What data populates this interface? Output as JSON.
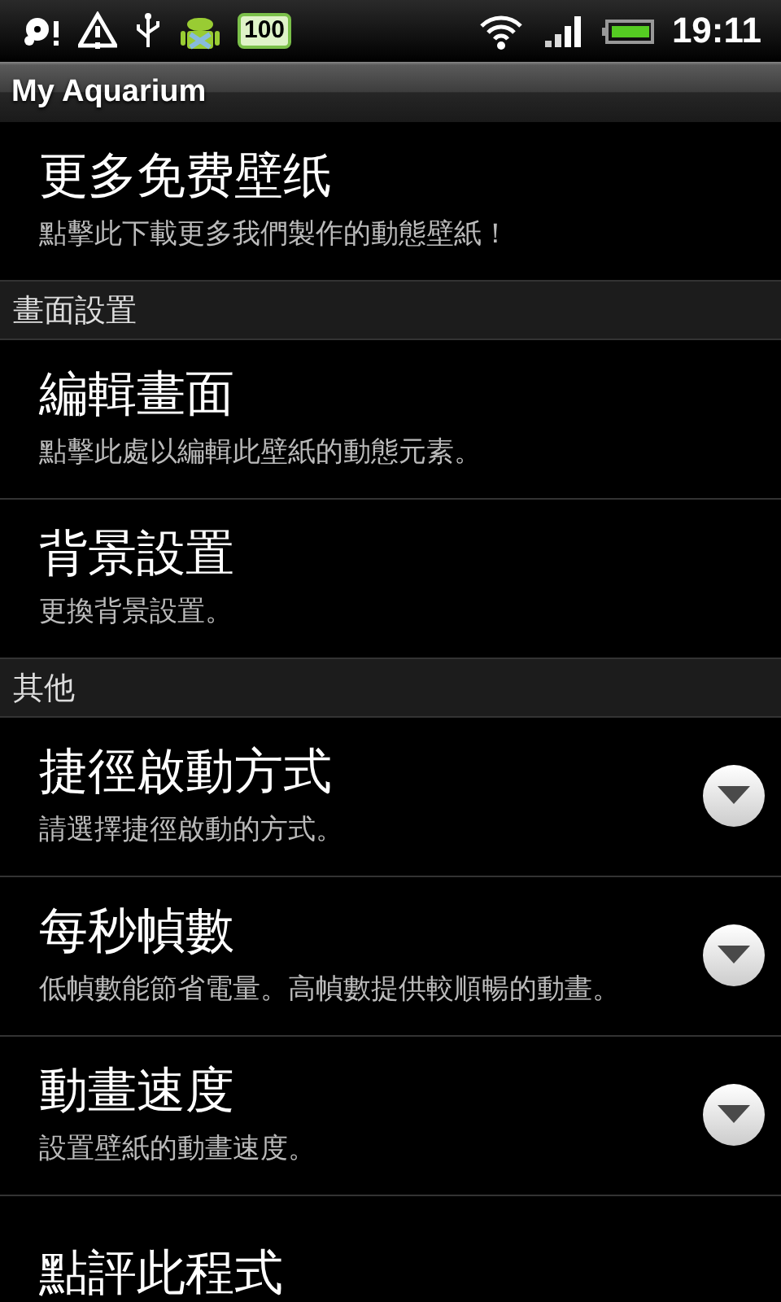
{
  "status_bar": {
    "battery_badge": "100",
    "time": "19:11"
  },
  "title_bar": {
    "title": "My Aquarium"
  },
  "sections": [
    {
      "items": [
        {
          "kind": "plain",
          "title": "更多免费壁纸",
          "summary": "點擊此下載更多我們製作的動態壁紙！"
        }
      ]
    },
    {
      "header": "畫面設置",
      "items": [
        {
          "kind": "plain",
          "title": "編輯畫面",
          "summary": "點擊此處以編輯此壁紙的動態元素。"
        },
        {
          "kind": "plain",
          "title": "背景設置",
          "summary": "更換背景設置。"
        }
      ]
    },
    {
      "header": "其他",
      "items": [
        {
          "kind": "list",
          "title": "捷徑啟動方式",
          "summary": "請選擇捷徑啟動的方式。"
        },
        {
          "kind": "list",
          "title": "每秒幀數",
          "summary": "低幀數能節省電量。高幀數提供較順暢的動畫。"
        },
        {
          "kind": "list",
          "title": "動畫速度",
          "summary": "設置壁紙的動畫速度。"
        },
        {
          "kind": "plain",
          "title": "點評此程式"
        }
      ]
    }
  ]
}
